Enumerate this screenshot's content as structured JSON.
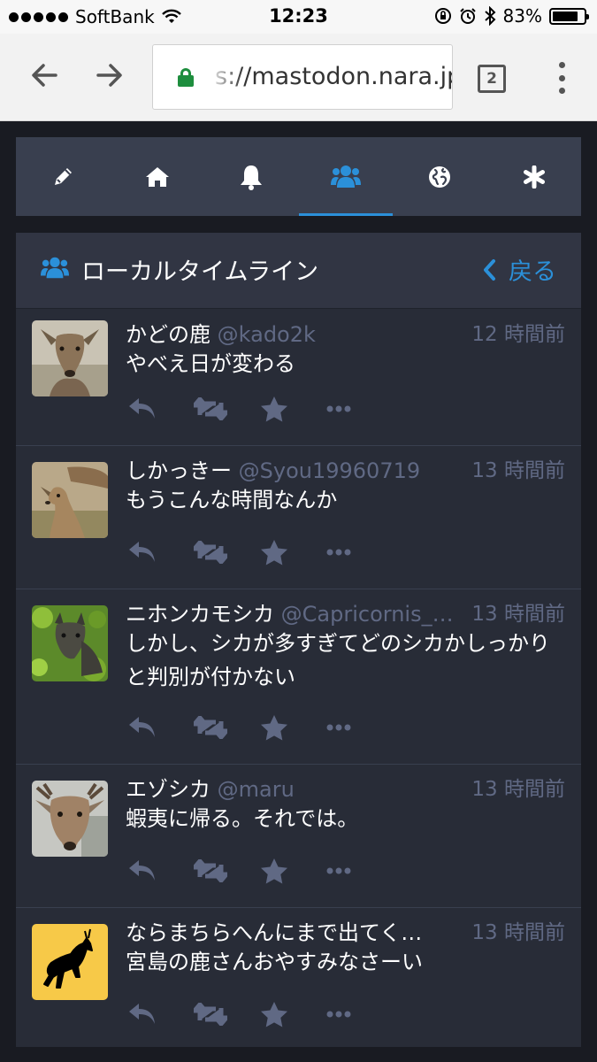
{
  "statusbar": {
    "carrier": "SoftBank",
    "time": "12:23",
    "battery": "83%",
    "battery_level": 0.83
  },
  "browser": {
    "url": "s://mastodon.nara.jp",
    "tab_count": "2"
  },
  "nav": {
    "tabs": [
      {
        "name": "compose",
        "icon": "pencil-icon"
      },
      {
        "name": "home",
        "icon": "home-icon"
      },
      {
        "name": "notifications",
        "icon": "bell-icon"
      },
      {
        "name": "local",
        "icon": "users-icon",
        "active": true
      },
      {
        "name": "federated",
        "icon": "globe-icon"
      },
      {
        "name": "getting-started",
        "icon": "asterisk-icon"
      }
    ]
  },
  "column": {
    "title": "ローカルタイムライン",
    "back_label": "戻る"
  },
  "statuses": [
    {
      "display_name": "かどの鹿",
      "acct": "@kado2k",
      "time": "12 時間前",
      "content": "やべえ日が変わる"
    },
    {
      "display_name": "しかっきー",
      "acct": "@Syou19960719",
      "time": "13 時間前",
      "content": "もうこんな時間なんか"
    },
    {
      "display_name": "ニホンカモシカ",
      "acct": "@Capricornis_…",
      "time": "13 時間前",
      "content": "しかし、シカが多すぎてどのシカかしっかりと判別が付かない"
    },
    {
      "display_name": "エゾシカ",
      "acct": "@maru",
      "time": "13 時間前",
      "content": "蝦夷に帰る。それでは。"
    },
    {
      "display_name": "ならまちらへんにまで出てく…",
      "acct": "",
      "time": "13 時間前",
      "content": "宮島の鹿さんおやすみなさーい"
    }
  ],
  "colors": {
    "accent": "#2b90d9",
    "background": "#191b22",
    "column": "#282c37",
    "nav": "#393f4f",
    "muted": "#606984"
  }
}
